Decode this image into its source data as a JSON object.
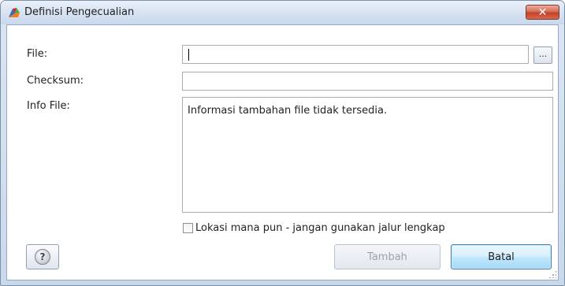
{
  "window": {
    "title": "Definisi Pengecualian",
    "close_label": "✕"
  },
  "form": {
    "file_label": "File:",
    "file_value": "",
    "browse_label": "...",
    "checksum_label": "Checksum:",
    "checksum_value": "",
    "info_label": "Info File:",
    "info_text": "Informasi tambahan file tidak tersedia.",
    "anywhere_checkbox_label": "Lokasi mana pun - jangan gunakan jalur lengkap",
    "anywhere_checked": false
  },
  "buttons": {
    "help_label": "?",
    "add_label": "Tambah",
    "cancel_label": "Batal"
  },
  "colors": {
    "avg_orange": "#f27c22",
    "avg_green": "#3fae49",
    "avg_blue": "#2a6ebd",
    "avg_red": "#d8262a"
  }
}
